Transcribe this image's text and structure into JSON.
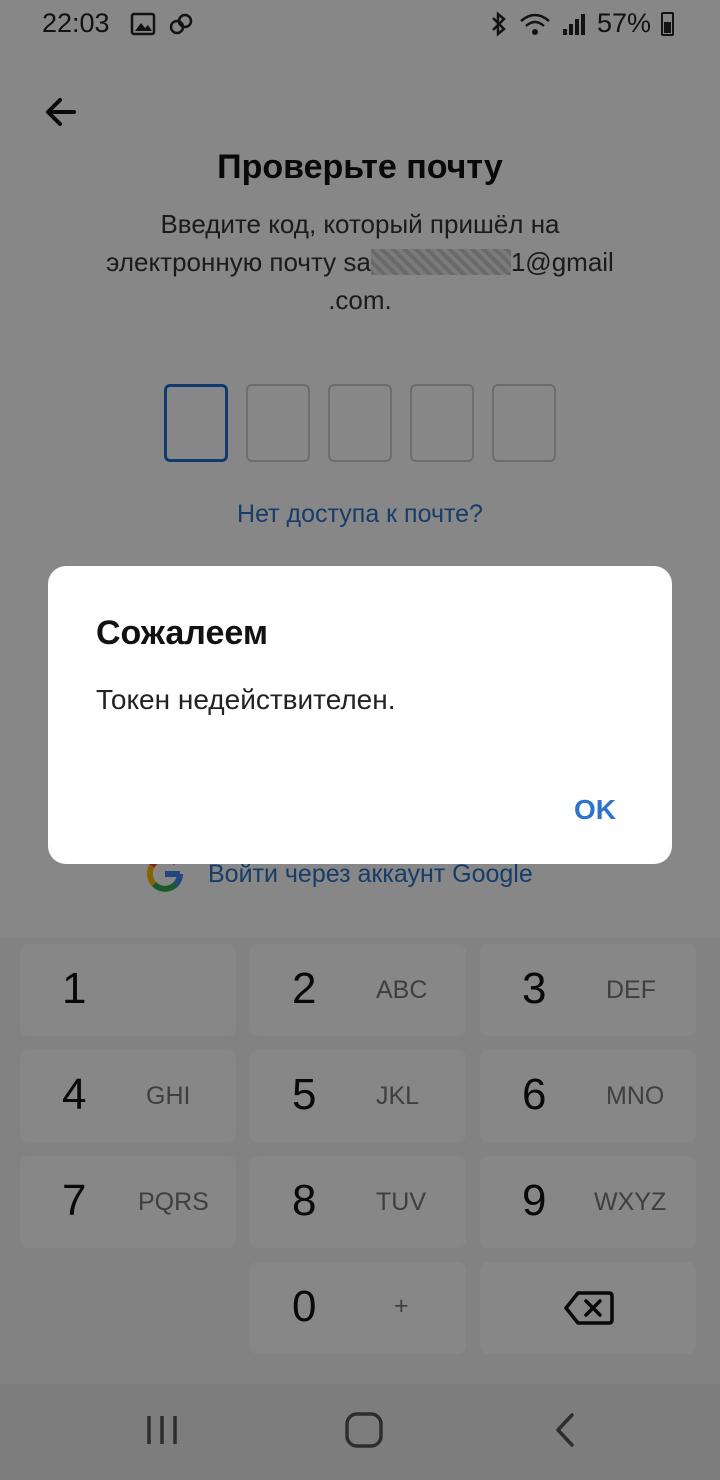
{
  "status_bar": {
    "time": "22:03",
    "battery": "57%",
    "icons": [
      "image-icon",
      "link-icon",
      "bluetooth-icon",
      "wifi-icon",
      "signal-icon",
      "battery-icon"
    ]
  },
  "header": {
    "title": "Проверьте почту",
    "subtitle_line1": "Введите код, который пришёл на",
    "subtitle_line2_prefix": "электронную почту sa",
    "subtitle_line2_suffix": "1@gmail",
    "subtitle_line3": ".com."
  },
  "code_input": {
    "length": 5,
    "active_index": 0
  },
  "links": {
    "no_access": "Нет доступа к почте?",
    "google_login": "Войти через аккаунт Google"
  },
  "keypad": {
    "keys": [
      {
        "digit": "1",
        "letters": ""
      },
      {
        "digit": "2",
        "letters": "ABC"
      },
      {
        "digit": "3",
        "letters": "DEF"
      },
      {
        "digit": "4",
        "letters": "GHI"
      },
      {
        "digit": "5",
        "letters": "JKL"
      },
      {
        "digit": "6",
        "letters": "MNO"
      },
      {
        "digit": "7",
        "letters": "PQRS"
      },
      {
        "digit": "8",
        "letters": "TUV"
      },
      {
        "digit": "9",
        "letters": "WXYZ"
      },
      {
        "digit": "0",
        "letters": "+"
      }
    ]
  },
  "dialog": {
    "title": "Сожалеем",
    "message": "Токен недействителен.",
    "ok_label": "OK"
  },
  "colors": {
    "accent": "#2b74c9",
    "active_border": "#1f6fd1",
    "overlay": "rgba(0,0,0,0.47)"
  }
}
